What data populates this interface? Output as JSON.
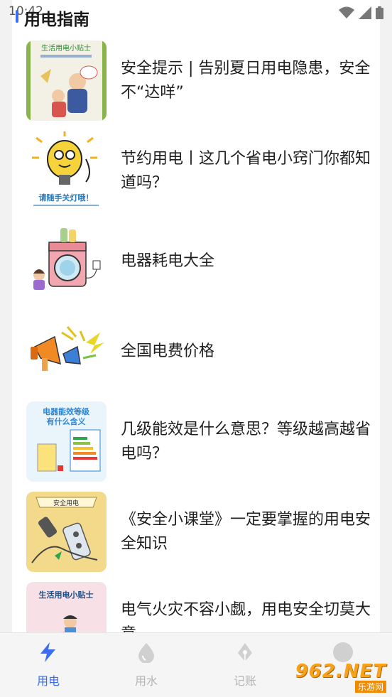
{
  "status_bar": {
    "time": "10:42"
  },
  "header": {
    "title": "用电指南"
  },
  "articles": [
    {
      "title": "安全提示 | 告别夏日用电隐患，安全不“达咩”",
      "thumb_caption": "生活用电小贴士"
    },
    {
      "title": "节约用电丨这几个省电小窍门你都知道吗？",
      "thumb_caption": "请随手关灯哦！"
    },
    {
      "title": "电器耗电大全"
    },
    {
      "title": "全国电费价格"
    },
    {
      "title": "几级能效是什么意思？等级越高越省电吗？",
      "thumb_caption": "电器能效等级有什么含义"
    },
    {
      "title": "《安全小课堂》一定要掌握的用电安全知识",
      "thumb_caption": "安全用电"
    },
    {
      "title": "电气火灾不容小觑，用电安全切莫大意",
      "thumb_caption": "生活用电小贴士"
    }
  ],
  "bottom_nav": [
    {
      "label": "用电",
      "icon": "lightning-icon",
      "active": true
    },
    {
      "label": "用水",
      "icon": "water-drop-icon",
      "active": false
    },
    {
      "label": "记账",
      "icon": "pen-nib-icon",
      "active": false
    },
    {
      "label": "",
      "icon": "profile-icon",
      "active": false
    }
  ],
  "watermark": {
    "main": "962.NET",
    "sub": "乐游网"
  },
  "colors": {
    "accent": "#3a6df0",
    "inactive": "#b5b5b5",
    "background": "#f2f2f2"
  }
}
